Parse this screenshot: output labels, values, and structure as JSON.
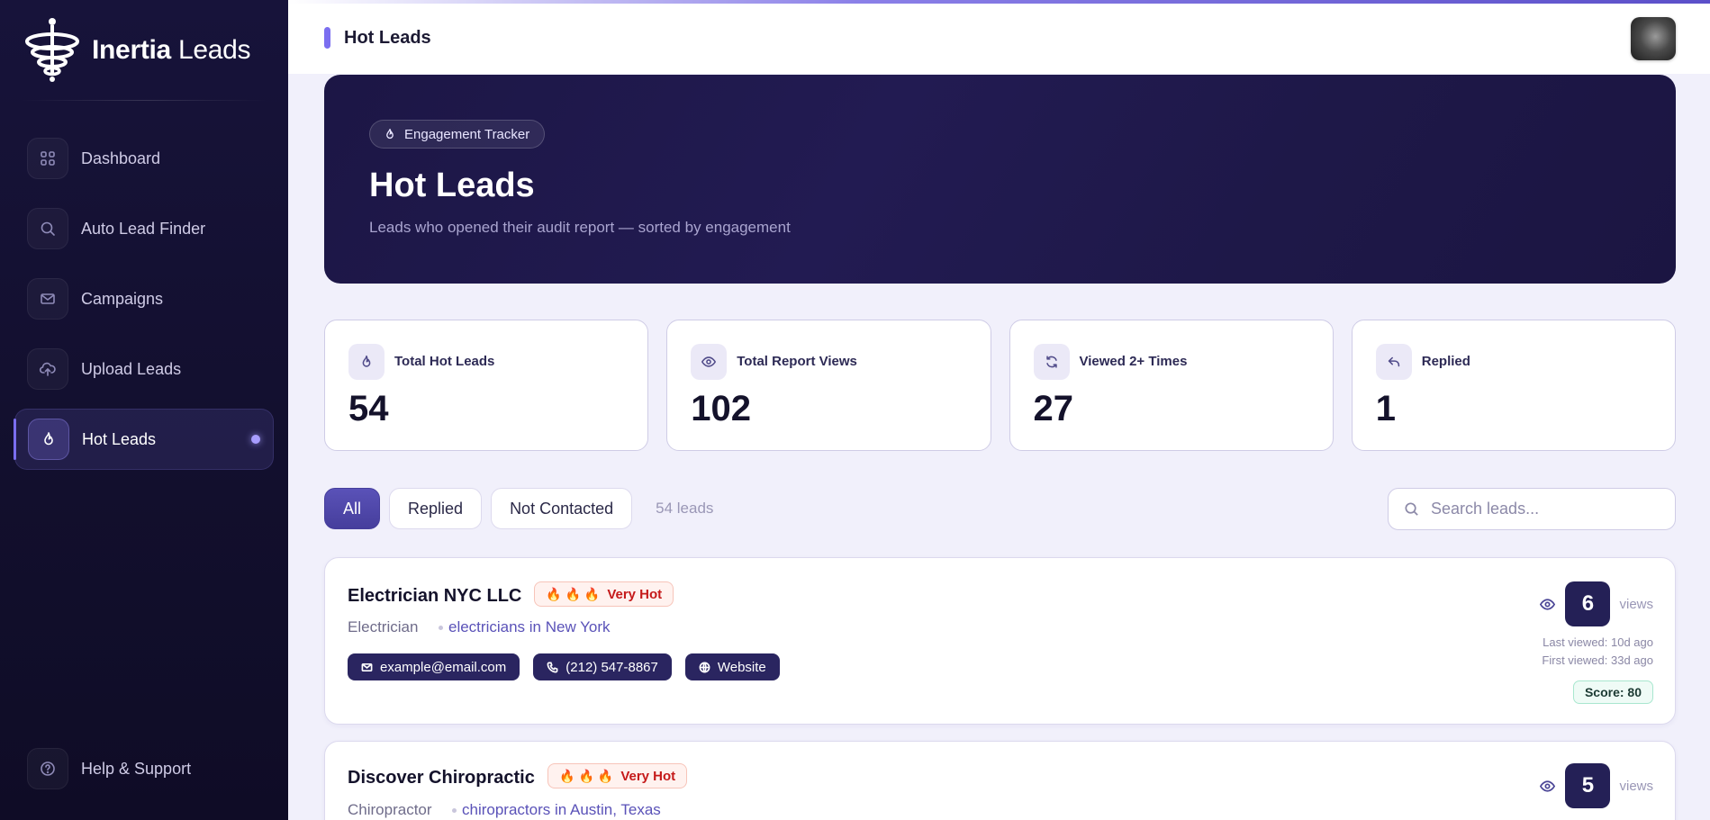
{
  "brand": {
    "name_bold": "Inertia",
    "name_light": "Leads"
  },
  "sidebar": {
    "items": [
      {
        "label": "Dashboard",
        "icon": "grid-icon"
      },
      {
        "label": "Auto Lead Finder",
        "icon": "search-icon"
      },
      {
        "label": "Campaigns",
        "icon": "mail-icon"
      },
      {
        "label": "Upload Leads",
        "icon": "upload-cloud-icon"
      },
      {
        "label": "Hot Leads",
        "icon": "flame-icon",
        "active": true
      }
    ],
    "help_label": "Help & Support"
  },
  "topbar": {
    "title": "Hot Leads"
  },
  "hero": {
    "chip_label": "Engagement Tracker",
    "title": "Hot Leads",
    "subtitle": "Leads who opened their audit report — sorted by engagement"
  },
  "stats": [
    {
      "label": "Total Hot Leads",
      "value": "54",
      "icon": "flame-icon"
    },
    {
      "label": "Total Report Views",
      "value": "102",
      "icon": "eye-icon"
    },
    {
      "label": "Viewed 2+ Times",
      "value": "27",
      "icon": "refresh-icon"
    },
    {
      "label": "Replied",
      "value": "1",
      "icon": "reply-icon"
    }
  ],
  "filters": {
    "all": "All",
    "replied": "Replied",
    "not_contacted": "Not Contacted",
    "count": "54 leads",
    "search_placeholder": "Search leads..."
  },
  "leads": [
    {
      "name": "Electrician NYC LLC",
      "heat_label": "Very Hot",
      "category": "Electrician",
      "search": "electricians in New York",
      "email": "example@email.com",
      "phone": "(212) 547-8867",
      "website": "Website",
      "views": "6",
      "views_label": "views",
      "last_viewed": "Last viewed: 10d ago",
      "first_viewed": "First viewed: 33d ago",
      "score": "Score: 80"
    },
    {
      "name": "Discover Chiropractic",
      "heat_label": "Very Hot",
      "category": "Chiropractor",
      "search": "chiropractors in Austin, Texas",
      "views": "5",
      "views_label": "views"
    }
  ],
  "colors": {
    "sidebar_bg": "#15112f",
    "accent": "#7b6ef0",
    "hero_bg": "#1f1849",
    "chip_bg": "#2a2560",
    "heat_text": "#c51a1a"
  }
}
